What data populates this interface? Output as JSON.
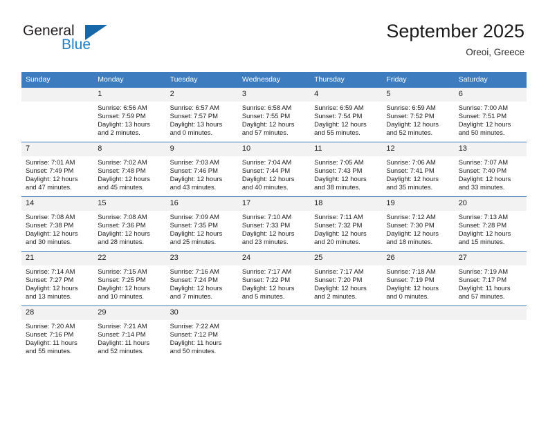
{
  "logo": {
    "word1": "General",
    "word2": "Blue",
    "brand_color": "#1f7fc4",
    "triangle_color": "#1668a8"
  },
  "header": {
    "title": "September 2025",
    "subtitle": "Oreoi, Greece",
    "header_bg_color": "#3c7cbf",
    "daynum_bg_color": "#f2f2f2"
  },
  "weekday_headers": [
    "Sunday",
    "Monday",
    "Tuesday",
    "Wednesday",
    "Thursday",
    "Friday",
    "Saturday"
  ],
  "weeks": [
    [
      {
        "day": "",
        "blank": true
      },
      {
        "day": "1",
        "sunrise": "Sunrise: 6:56 AM",
        "sunset": "Sunset: 7:59 PM",
        "daylight1": "Daylight: 13 hours",
        "daylight2": "and 2 minutes."
      },
      {
        "day": "2",
        "sunrise": "Sunrise: 6:57 AM",
        "sunset": "Sunset: 7:57 PM",
        "daylight1": "Daylight: 13 hours",
        "daylight2": "and 0 minutes."
      },
      {
        "day": "3",
        "sunrise": "Sunrise: 6:58 AM",
        "sunset": "Sunset: 7:55 PM",
        "daylight1": "Daylight: 12 hours",
        "daylight2": "and 57 minutes."
      },
      {
        "day": "4",
        "sunrise": "Sunrise: 6:59 AM",
        "sunset": "Sunset: 7:54 PM",
        "daylight1": "Daylight: 12 hours",
        "daylight2": "and 55 minutes."
      },
      {
        "day": "5",
        "sunrise": "Sunrise: 6:59 AM",
        "sunset": "Sunset: 7:52 PM",
        "daylight1": "Daylight: 12 hours",
        "daylight2": "and 52 minutes."
      },
      {
        "day": "6",
        "sunrise": "Sunrise: 7:00 AM",
        "sunset": "Sunset: 7:51 PM",
        "daylight1": "Daylight: 12 hours",
        "daylight2": "and 50 minutes."
      }
    ],
    [
      {
        "day": "7",
        "sunrise": "Sunrise: 7:01 AM",
        "sunset": "Sunset: 7:49 PM",
        "daylight1": "Daylight: 12 hours",
        "daylight2": "and 47 minutes."
      },
      {
        "day": "8",
        "sunrise": "Sunrise: 7:02 AM",
        "sunset": "Sunset: 7:48 PM",
        "daylight1": "Daylight: 12 hours",
        "daylight2": "and 45 minutes."
      },
      {
        "day": "9",
        "sunrise": "Sunrise: 7:03 AM",
        "sunset": "Sunset: 7:46 PM",
        "daylight1": "Daylight: 12 hours",
        "daylight2": "and 43 minutes."
      },
      {
        "day": "10",
        "sunrise": "Sunrise: 7:04 AM",
        "sunset": "Sunset: 7:44 PM",
        "daylight1": "Daylight: 12 hours",
        "daylight2": "and 40 minutes."
      },
      {
        "day": "11",
        "sunrise": "Sunrise: 7:05 AM",
        "sunset": "Sunset: 7:43 PM",
        "daylight1": "Daylight: 12 hours",
        "daylight2": "and 38 minutes."
      },
      {
        "day": "12",
        "sunrise": "Sunrise: 7:06 AM",
        "sunset": "Sunset: 7:41 PM",
        "daylight1": "Daylight: 12 hours",
        "daylight2": "and 35 minutes."
      },
      {
        "day": "13",
        "sunrise": "Sunrise: 7:07 AM",
        "sunset": "Sunset: 7:40 PM",
        "daylight1": "Daylight: 12 hours",
        "daylight2": "and 33 minutes."
      }
    ],
    [
      {
        "day": "14",
        "sunrise": "Sunrise: 7:08 AM",
        "sunset": "Sunset: 7:38 PM",
        "daylight1": "Daylight: 12 hours",
        "daylight2": "and 30 minutes."
      },
      {
        "day": "15",
        "sunrise": "Sunrise: 7:08 AM",
        "sunset": "Sunset: 7:36 PM",
        "daylight1": "Daylight: 12 hours",
        "daylight2": "and 28 minutes."
      },
      {
        "day": "16",
        "sunrise": "Sunrise: 7:09 AM",
        "sunset": "Sunset: 7:35 PM",
        "daylight1": "Daylight: 12 hours",
        "daylight2": "and 25 minutes."
      },
      {
        "day": "17",
        "sunrise": "Sunrise: 7:10 AM",
        "sunset": "Sunset: 7:33 PM",
        "daylight1": "Daylight: 12 hours",
        "daylight2": "and 23 minutes."
      },
      {
        "day": "18",
        "sunrise": "Sunrise: 7:11 AM",
        "sunset": "Sunset: 7:32 PM",
        "daylight1": "Daylight: 12 hours",
        "daylight2": "and 20 minutes."
      },
      {
        "day": "19",
        "sunrise": "Sunrise: 7:12 AM",
        "sunset": "Sunset: 7:30 PM",
        "daylight1": "Daylight: 12 hours",
        "daylight2": "and 18 minutes."
      },
      {
        "day": "20",
        "sunrise": "Sunrise: 7:13 AM",
        "sunset": "Sunset: 7:28 PM",
        "daylight1": "Daylight: 12 hours",
        "daylight2": "and 15 minutes."
      }
    ],
    [
      {
        "day": "21",
        "sunrise": "Sunrise: 7:14 AM",
        "sunset": "Sunset: 7:27 PM",
        "daylight1": "Daylight: 12 hours",
        "daylight2": "and 13 minutes."
      },
      {
        "day": "22",
        "sunrise": "Sunrise: 7:15 AM",
        "sunset": "Sunset: 7:25 PM",
        "daylight1": "Daylight: 12 hours",
        "daylight2": "and 10 minutes."
      },
      {
        "day": "23",
        "sunrise": "Sunrise: 7:16 AM",
        "sunset": "Sunset: 7:24 PM",
        "daylight1": "Daylight: 12 hours",
        "daylight2": "and 7 minutes."
      },
      {
        "day": "24",
        "sunrise": "Sunrise: 7:17 AM",
        "sunset": "Sunset: 7:22 PM",
        "daylight1": "Daylight: 12 hours",
        "daylight2": "and 5 minutes."
      },
      {
        "day": "25",
        "sunrise": "Sunrise: 7:17 AM",
        "sunset": "Sunset: 7:20 PM",
        "daylight1": "Daylight: 12 hours",
        "daylight2": "and 2 minutes."
      },
      {
        "day": "26",
        "sunrise": "Sunrise: 7:18 AM",
        "sunset": "Sunset: 7:19 PM",
        "daylight1": "Daylight: 12 hours",
        "daylight2": "and 0 minutes."
      },
      {
        "day": "27",
        "sunrise": "Sunrise: 7:19 AM",
        "sunset": "Sunset: 7:17 PM",
        "daylight1": "Daylight: 11 hours",
        "daylight2": "and 57 minutes."
      }
    ],
    [
      {
        "day": "28",
        "sunrise": "Sunrise: 7:20 AM",
        "sunset": "Sunset: 7:16 PM",
        "daylight1": "Daylight: 11 hours",
        "daylight2": "and 55 minutes."
      },
      {
        "day": "29",
        "sunrise": "Sunrise: 7:21 AM",
        "sunset": "Sunset: 7:14 PM",
        "daylight1": "Daylight: 11 hours",
        "daylight2": "and 52 minutes."
      },
      {
        "day": "30",
        "sunrise": "Sunrise: 7:22 AM",
        "sunset": "Sunset: 7:12 PM",
        "daylight1": "Daylight: 11 hours",
        "daylight2": "and 50 minutes."
      },
      {
        "day": "",
        "blank": true
      },
      {
        "day": "",
        "blank": true
      },
      {
        "day": "",
        "blank": true
      },
      {
        "day": "",
        "blank": true
      }
    ]
  ]
}
